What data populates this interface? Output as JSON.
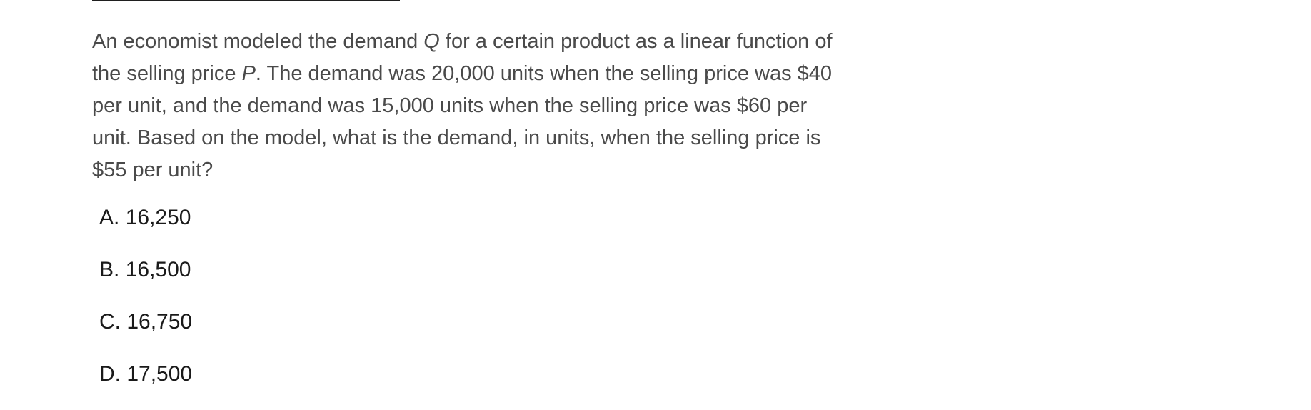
{
  "question": {
    "part1": "An economist modeled the demand ",
    "var_q": "Q",
    "part2": " for a certain product as a linear function of the selling price ",
    "var_p": "P",
    "part3": ". The demand was 20,000 units when the selling price was $40 per unit, and the demand was 15,000 units when the selling price was $60 per unit. Based on the model, what is the demand, in units, when the selling price is $55 per unit?"
  },
  "choices": [
    {
      "letter": "A.",
      "value": "16,250"
    },
    {
      "letter": "B.",
      "value": "16,500"
    },
    {
      "letter": "C.",
      "value": "16,750"
    },
    {
      "letter": "D.",
      "value": "17,500"
    }
  ]
}
